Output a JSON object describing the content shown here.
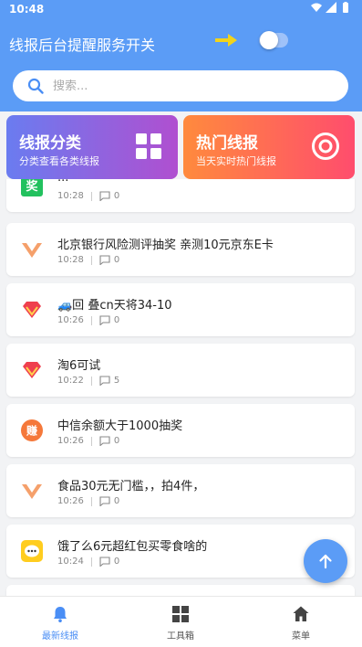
{
  "status_bar": {
    "time": "10:48"
  },
  "header": {
    "title": "线报后台提醒服务开关",
    "toggle_on": false
  },
  "search": {
    "placeholder": "搜索..."
  },
  "categories": [
    {
      "title": "线报分类",
      "subtitle": "分类查看各类线报",
      "icon": "grid-icon"
    },
    {
      "title": "热门线报",
      "subtitle": "当天实时热门线报",
      "icon": "target-icon"
    }
  ],
  "feed": [
    {
      "title": "...",
      "time": "10:28",
      "comments": "0",
      "icon": "green-bonus-icon"
    },
    {
      "title": "北京银行风险测评抽奖 亲测10元京东E卡",
      "time": "10:28",
      "comments": "0",
      "icon": "orange-v-icon"
    },
    {
      "title": "🚙回 叠cn天将34-10",
      "time": "10:26",
      "comments": "0",
      "icon": "red-diamond-icon"
    },
    {
      "title": "淘6可试",
      "time": "10:22",
      "comments": "5",
      "icon": "red-diamond-icon"
    },
    {
      "title": "中信余额大于1000抽奖",
      "time": "10:26",
      "comments": "0",
      "icon": "zhuan-icon"
    },
    {
      "title": "食品30元无门槛，，拍4件，",
      "time": "10:26",
      "comments": "0",
      "icon": "orange-v-icon"
    },
    {
      "title": "饿了么6元超红包买零食啥的",
      "time": "10:24",
      "comments": "0",
      "icon": "yellow-chat-icon"
    }
  ],
  "bottom_nav": [
    {
      "label": "最新线报",
      "icon": "bell-icon",
      "active": true
    },
    {
      "label": "工具箱",
      "icon": "grid-icon",
      "active": false
    },
    {
      "label": "菜单",
      "icon": "home-icon",
      "active": false
    }
  ],
  "colors": {
    "primary": "#5b9cf6",
    "arrow": "#f2d31b"
  }
}
